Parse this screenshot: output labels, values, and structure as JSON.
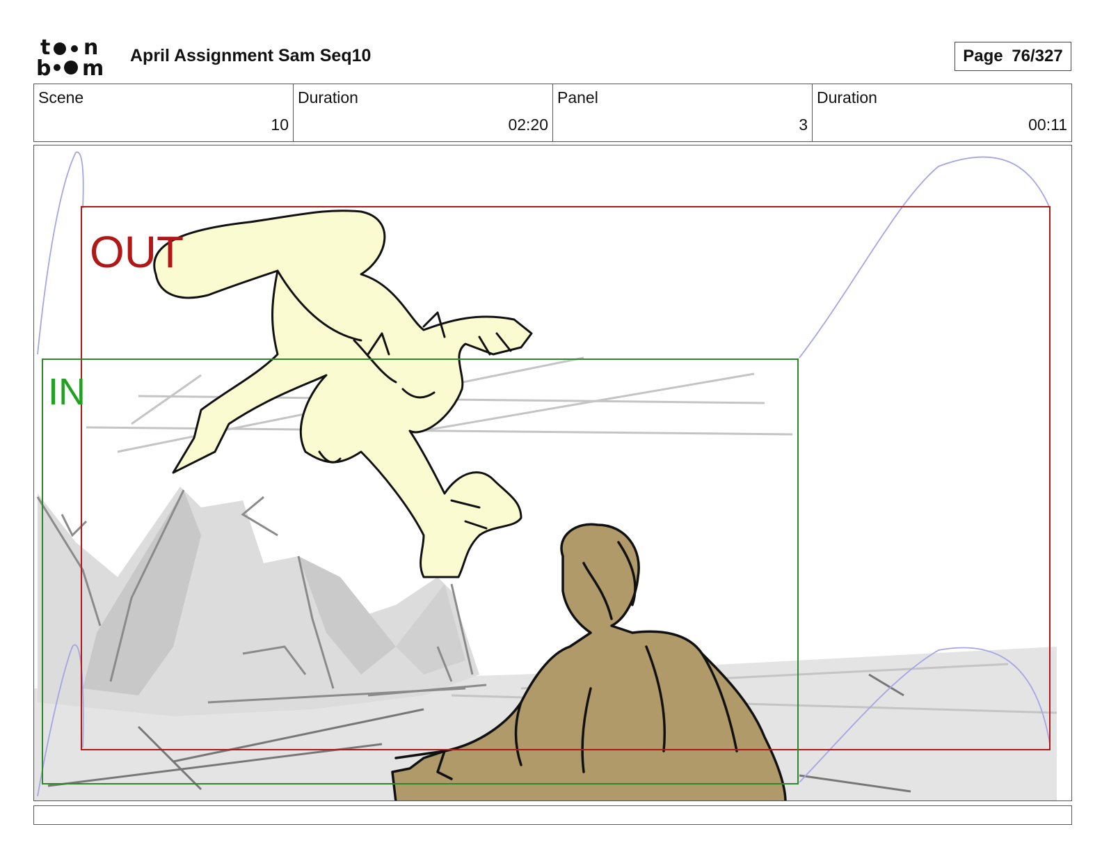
{
  "header": {
    "logo_text_top": "toon",
    "logo_text_bottom": "boom",
    "title": "April Assignment Sam Seq10",
    "page_label": "Page",
    "page_value": "76/327"
  },
  "info": {
    "scene_label": "Scene",
    "scene_value": "10",
    "scene_duration_label": "Duration",
    "scene_duration_value": "02:20",
    "panel_label": "Panel",
    "panel_value": "3",
    "panel_duration_label": "Duration",
    "panel_duration_value": "00:11"
  },
  "panel": {
    "out_label": "OUT",
    "in_label": "IN",
    "colors": {
      "out_frame": "#b01818",
      "in_frame": "#2a8a2a",
      "camera_path": "#9b9be0",
      "creature_fill": "#fbfbd2",
      "man_fill": "#b09a6a",
      "rocks": "#cfcfcf",
      "ground": "#e2e2e2"
    }
  },
  "caption": {}
}
